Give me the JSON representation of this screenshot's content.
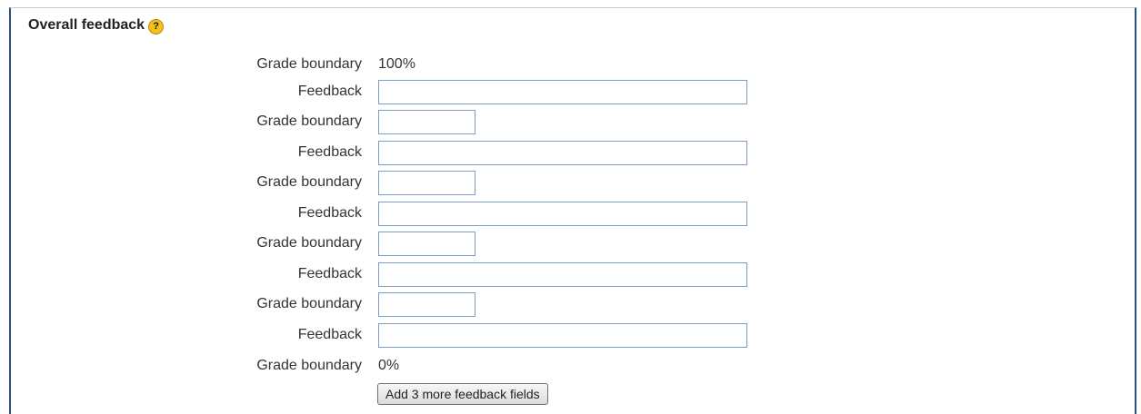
{
  "section": {
    "title": "Overall feedback",
    "help_icon": "question-mark-help-icon",
    "help_glyph": "?"
  },
  "rows": {
    "gb_100": {
      "label": "Grade boundary",
      "value": "100%"
    },
    "fb_1": {
      "label": "Feedback",
      "value": ""
    },
    "gb_1": {
      "label": "Grade boundary",
      "value": ""
    },
    "fb_2": {
      "label": "Feedback",
      "value": ""
    },
    "gb_2": {
      "label": "Grade boundary",
      "value": ""
    },
    "fb_3": {
      "label": "Feedback",
      "value": ""
    },
    "gb_3": {
      "label": "Grade boundary",
      "value": ""
    },
    "fb_4": {
      "label": "Feedback",
      "value": ""
    },
    "gb_4": {
      "label": "Grade boundary",
      "value": ""
    },
    "fb_5": {
      "label": "Feedback",
      "value": ""
    },
    "gb_0": {
      "label": "Grade boundary",
      "value": "0%"
    }
  },
  "add_button_label": "Add 3 more feedback fields",
  "colors": {
    "frame_border": "#2c4f7c",
    "input_border": "#7a9cc6",
    "help_icon": "#f3c21a"
  }
}
